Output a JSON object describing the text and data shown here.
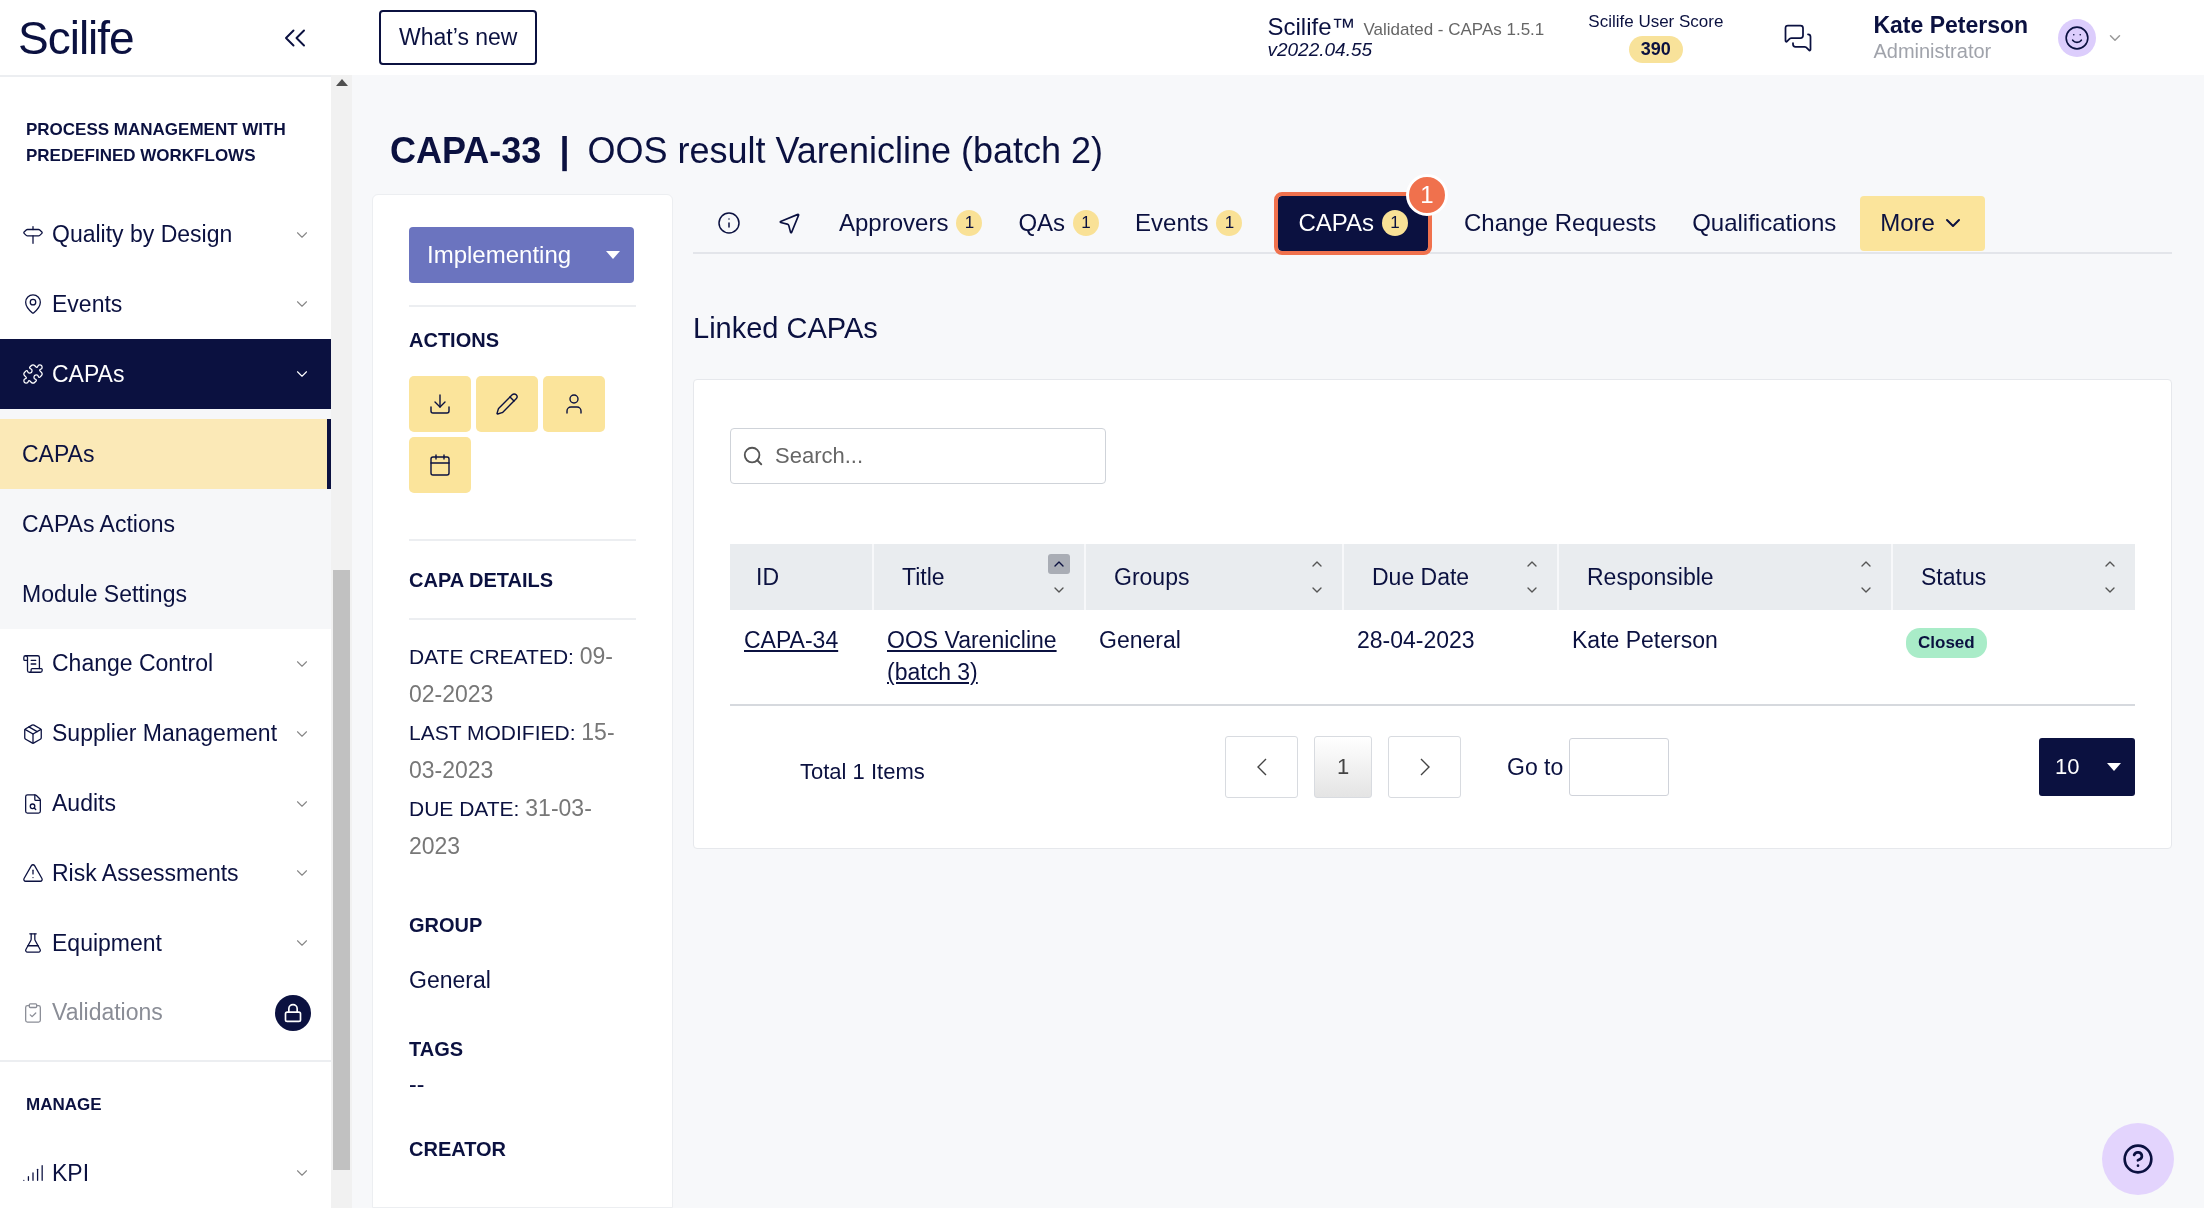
{
  "header": {
    "logo": "Scilife",
    "whats_new": "What’s new",
    "product": "Scilife™",
    "validation": "Validated - CAPAs 1.5.1",
    "version": "v2022.04.55",
    "score_label": "Scilife User Score",
    "score": "390",
    "user_name": "Kate Peterson",
    "user_role": "Administrator"
  },
  "sidebar": {
    "section_title": "PROCESS MANAGEMENT WITH PREDEFINED WORKFLOWS",
    "items": [
      {
        "label": "Quality by Design",
        "selected": false,
        "locked": false
      },
      {
        "label": "Events",
        "selected": false,
        "locked": false
      },
      {
        "label": "CAPAs",
        "selected": true,
        "locked": false,
        "children": [
          {
            "label": "CAPAs",
            "selected": true
          },
          {
            "label": "CAPAs Actions",
            "selected": false
          },
          {
            "label": "Module Settings",
            "selected": false
          }
        ]
      },
      {
        "label": "Change Control",
        "selected": false,
        "locked": false
      },
      {
        "label": "Supplier Management",
        "selected": false,
        "locked": false
      },
      {
        "label": "Audits",
        "selected": false,
        "locked": false
      },
      {
        "label": "Risk Assessments",
        "selected": false,
        "locked": false
      },
      {
        "label": "Equipment",
        "selected": false,
        "locked": false
      },
      {
        "label": "Validations",
        "selected": false,
        "locked": true
      }
    ],
    "manage_title": "MANAGE",
    "manage_items": [
      {
        "label": "KPI",
        "selected": false,
        "locked": false
      }
    ]
  },
  "title": {
    "id": "CAPA-33",
    "separator": "|",
    "name": "OOS result Varenicline (batch 2)"
  },
  "details": {
    "status": "Implementing",
    "actions_title": "ACTIONS",
    "section_title": "CAPA DETAILS",
    "fields": [
      {
        "label": "DATE CREATED:",
        "value": "09-02-2023"
      },
      {
        "label": "LAST MODIFIED:",
        "value": "15-03-2023"
      },
      {
        "label": "DUE DATE:",
        "value": "31-03-2023"
      }
    ],
    "group_title": "GROUP",
    "group": "General",
    "tags_title": "TAGS",
    "tags": "--",
    "creator_title": "CREATOR"
  },
  "tabs": [
    {
      "kind": "info",
      "selected": false
    },
    {
      "kind": "pointer",
      "selected": false
    },
    {
      "kind": "label",
      "label": "Approvers",
      "count": "1",
      "selected": false
    },
    {
      "kind": "label",
      "label": "QAs",
      "count": "1",
      "selected": false
    },
    {
      "kind": "label",
      "label": "Events",
      "count": "1",
      "selected": false
    },
    {
      "kind": "label",
      "label": "CAPAs",
      "count": "1",
      "notification": "1",
      "selected": true
    },
    {
      "kind": "label",
      "label": "Change Requests",
      "selected": false
    },
    {
      "kind": "label",
      "label": "Qualifications",
      "selected": false
    }
  ],
  "more_button": {
    "label": "More"
  },
  "linked_title": "Linked CAPAs",
  "search": {
    "placeholder": "Search..."
  },
  "table": {
    "columns": [
      {
        "label": "ID",
        "sortable": false
      },
      {
        "label": "Title",
        "sortable": true,
        "sorted": true
      },
      {
        "label": "Groups",
        "sortable": true,
        "sorted": false
      },
      {
        "label": "Due Date",
        "sortable": true,
        "sorted": false
      },
      {
        "label": "Responsible",
        "sortable": true,
        "sorted": false
      },
      {
        "label": "Status",
        "sortable": true,
        "sorted": false
      }
    ],
    "rows": [
      {
        "cells": [
          {
            "kind": "link",
            "text": "CAPA-34"
          },
          {
            "kind": "link",
            "text": "OOS Varenicline (batch 3)"
          },
          {
            "kind": "text",
            "text": "General"
          },
          {
            "kind": "text",
            "text": "28-04-2023"
          },
          {
            "kind": "text",
            "text": "Kate Peterson"
          },
          {
            "kind": "status",
            "text": "Closed"
          }
        ]
      }
    ]
  },
  "pagination": {
    "total": "Total 1 Items",
    "pages": [
      {
        "label": "1",
        "selected": true
      }
    ],
    "goto_label": "Go to",
    "page_size": "10"
  }
}
